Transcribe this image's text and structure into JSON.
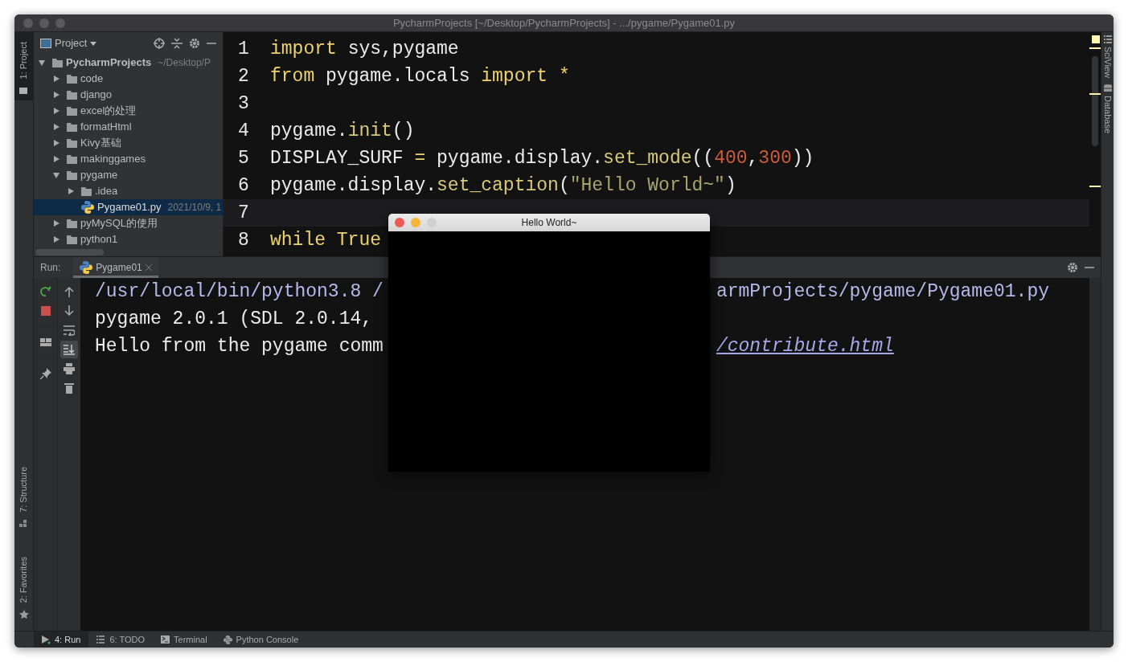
{
  "window": {
    "title": "PycharmProjects [~/Desktop/PycharmProjects] - .../pygame/Pygame01.py"
  },
  "left_strip": [
    {
      "label": "1: Project",
      "selected": true
    },
    {
      "label": "7: Structure",
      "selected": false
    },
    {
      "label": "2: Favorites",
      "selected": false
    }
  ],
  "project_panel": {
    "title": "Project",
    "tree": [
      {
        "label": "PycharmProjects",
        "hint": "~/Desktop/P",
        "kind": "folder",
        "expanded": true,
        "selected": false,
        "children": [
          {
            "label": "code",
            "kind": "folder",
            "expanded": false,
            "selected": false
          },
          {
            "label": "django",
            "kind": "folder",
            "expanded": false,
            "selected": false
          },
          {
            "label": "excel的处理",
            "kind": "folder",
            "expanded": false,
            "selected": false
          },
          {
            "label": "formatHtml",
            "kind": "folder",
            "expanded": false,
            "selected": false
          },
          {
            "label": "Kivy基础",
            "kind": "folder",
            "expanded": false,
            "selected": false
          },
          {
            "label": "makinggames",
            "kind": "folder",
            "expanded": false,
            "selected": false
          },
          {
            "label": "pygame",
            "kind": "folder",
            "expanded": true,
            "selected": false,
            "children": [
              {
                "label": ".idea",
                "kind": "folder",
                "expanded": false,
                "selected": false
              },
              {
                "label": "Pygame01.py",
                "hint": "2021/10/9, 1",
                "kind": "file",
                "selected": true
              }
            ]
          },
          {
            "label": "pyMySQL的使用",
            "kind": "folder",
            "expanded": false,
            "selected": false
          },
          {
            "label": "python1",
            "kind": "folder",
            "expanded": false,
            "selected": false
          }
        ]
      }
    ]
  },
  "editor": {
    "lines": [
      {
        "number": "1",
        "current": false,
        "tokens": [
          {
            "text": "import",
            "kind": "keyword"
          },
          {
            "text": " sys,pygame",
            "kind": "plain"
          }
        ]
      },
      {
        "number": "2",
        "current": false,
        "tokens": [
          {
            "text": "from",
            "kind": "keyword"
          },
          {
            "text": " pygame.locals ",
            "kind": "plain"
          },
          {
            "text": "import",
            "kind": "keyword"
          },
          {
            "text": " *",
            "kind": "keyword"
          }
        ]
      },
      {
        "number": "3",
        "current": false
      },
      {
        "number": "4",
        "current": false,
        "tokens": [
          {
            "text": "pygame.",
            "kind": "plain"
          },
          {
            "text": "init",
            "kind": "function"
          },
          {
            "text": "()",
            "kind": "plain"
          }
        ]
      },
      {
        "number": "5",
        "current": false,
        "tokens": [
          {
            "text": "DISPLAY_SURF ",
            "kind": "plain"
          },
          {
            "text": "=",
            "kind": "keyword"
          },
          {
            "text": " pygame.display.",
            "kind": "plain"
          },
          {
            "text": "set_mode",
            "kind": "function"
          },
          {
            "text": "((",
            "kind": "plain"
          },
          {
            "text": "400",
            "kind": "number"
          },
          {
            "text": ",",
            "kind": "plain"
          },
          {
            "text": "300",
            "kind": "number"
          },
          {
            "text": "))",
            "kind": "plain"
          }
        ]
      },
      {
        "number": "6",
        "current": false,
        "tokens": [
          {
            "text": "pygame.display.",
            "kind": "plain"
          },
          {
            "text": "set_caption",
            "kind": "function"
          },
          {
            "text": "(",
            "kind": "plain"
          },
          {
            "text": "\"Hello World~\"",
            "kind": "string"
          },
          {
            "text": ")",
            "kind": "plain"
          }
        ]
      },
      {
        "number": "7",
        "current": true
      },
      {
        "number": "8",
        "current": false,
        "tokens": [
          {
            "text": "while True",
            "kind": "keyword"
          }
        ]
      }
    ]
  },
  "right_strip": [
    {
      "label": "SciView"
    },
    {
      "label": "Database"
    }
  ],
  "run_panel": {
    "label": "Run:",
    "tabs": [
      {
        "label": "Pygame01",
        "selected": true
      }
    ],
    "scroll_to_end_on": true,
    "console": [
      {
        "segments": [
          {
            "text": "/usr/local/bin/python3.8 /",
            "kind": "command"
          },
          {
            "text": "armProjects/pygame/Pygame01.py",
            "kind": "command"
          }
        ]
      },
      {
        "segments": [
          {
            "text": "pygame 2.0.1 (SDL 2.0.14,",
            "kind": "output"
          }
        ]
      },
      {
        "segments": [
          {
            "text": "Hello from the pygame comm",
            "kind": "output"
          },
          {
            "text": "/contribute.html",
            "kind": "link"
          }
        ]
      }
    ]
  },
  "bottom_bar": [
    {
      "label": "4: Run",
      "selected": true
    },
    {
      "label": "6: TODO",
      "selected": false
    },
    {
      "label": "Terminal",
      "selected": false
    },
    {
      "label": "Python Console",
      "selected": false
    }
  ],
  "popup_window": {
    "title": "Hello World~"
  }
}
